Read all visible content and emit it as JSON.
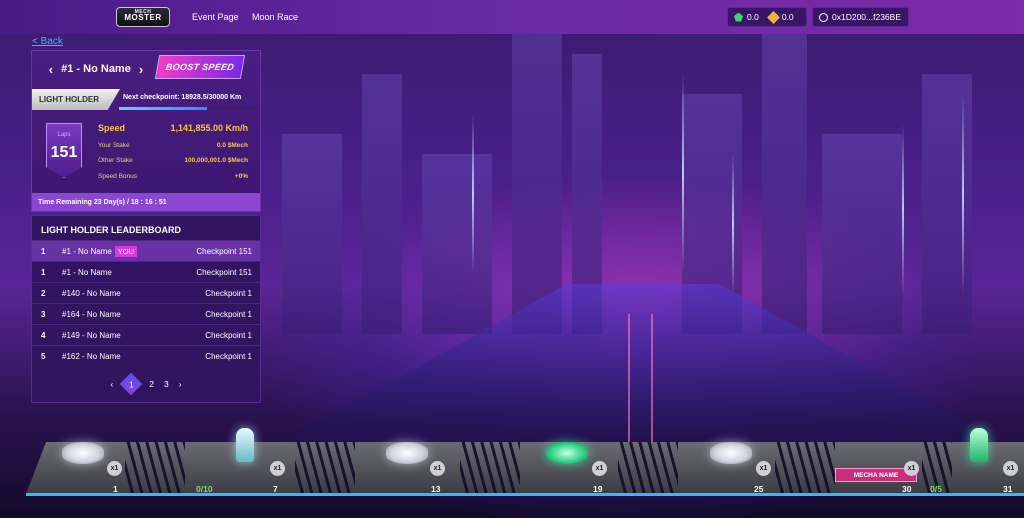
{
  "topbar": {
    "logo_text": "MOSTER",
    "logo_sub": "MECH",
    "nav": [
      "Event Page",
      "Moon Race"
    ],
    "balance_green": "0.0",
    "balance_yellow": "0.0",
    "address": "0x1D200...f236BE"
  },
  "back_label": "< Back",
  "racer": {
    "name": "#1 - No Name",
    "boost_label": "BOOST SPEED",
    "tier": "LIGHT HOLDER",
    "next_checkpoint": "Next checkpoint: 18928.5/30000 Km",
    "checkpoint_progress": 0.631,
    "laps_label": "Laps",
    "laps_value": "151",
    "stats": {
      "speed_label": "Speed",
      "speed_value": "1,141,855.00 Km/h",
      "your_stake_label": "Your Stake",
      "your_stake_value": "0.0 $Mech",
      "other_stake_label": "Other Stake",
      "other_stake_value": "100,000,001.0 $Mech",
      "bonus_label": "Speed Bonus",
      "bonus_value": "+0%"
    },
    "time_remaining": "Time Remaining 23 Day(s) / 18 : 16 : 51"
  },
  "leaderboard": {
    "title": "LIGHT HOLDER LEADERBOARD",
    "you_badge": "YOU",
    "rows": [
      {
        "rank": "1",
        "name": "#1 - No Name",
        "checkpoint": "Checkpoint 151"
      },
      {
        "rank": "1",
        "name": "#1 - No Name",
        "checkpoint": "Checkpoint 151"
      },
      {
        "rank": "2",
        "name": "#140 - No Name",
        "checkpoint": "Checkpoint 1"
      },
      {
        "rank": "3",
        "name": "#164 - No Name",
        "checkpoint": "Checkpoint 1"
      },
      {
        "rank": "4",
        "name": "#149 - No Name",
        "checkpoint": "Checkpoint 1"
      },
      {
        "rank": "5",
        "name": "#162 - No Name",
        "checkpoint": "Checkpoint 1"
      }
    ],
    "pages": [
      "1",
      "2",
      "3"
    ]
  },
  "track": {
    "qty_label": "x1",
    "checkpoints": [
      "1",
      "7",
      "13",
      "19",
      "25",
      "30",
      "31"
    ],
    "fractions": [
      "0/10",
      "0/5"
    ],
    "mecha_tag": "MECHA NAME"
  }
}
